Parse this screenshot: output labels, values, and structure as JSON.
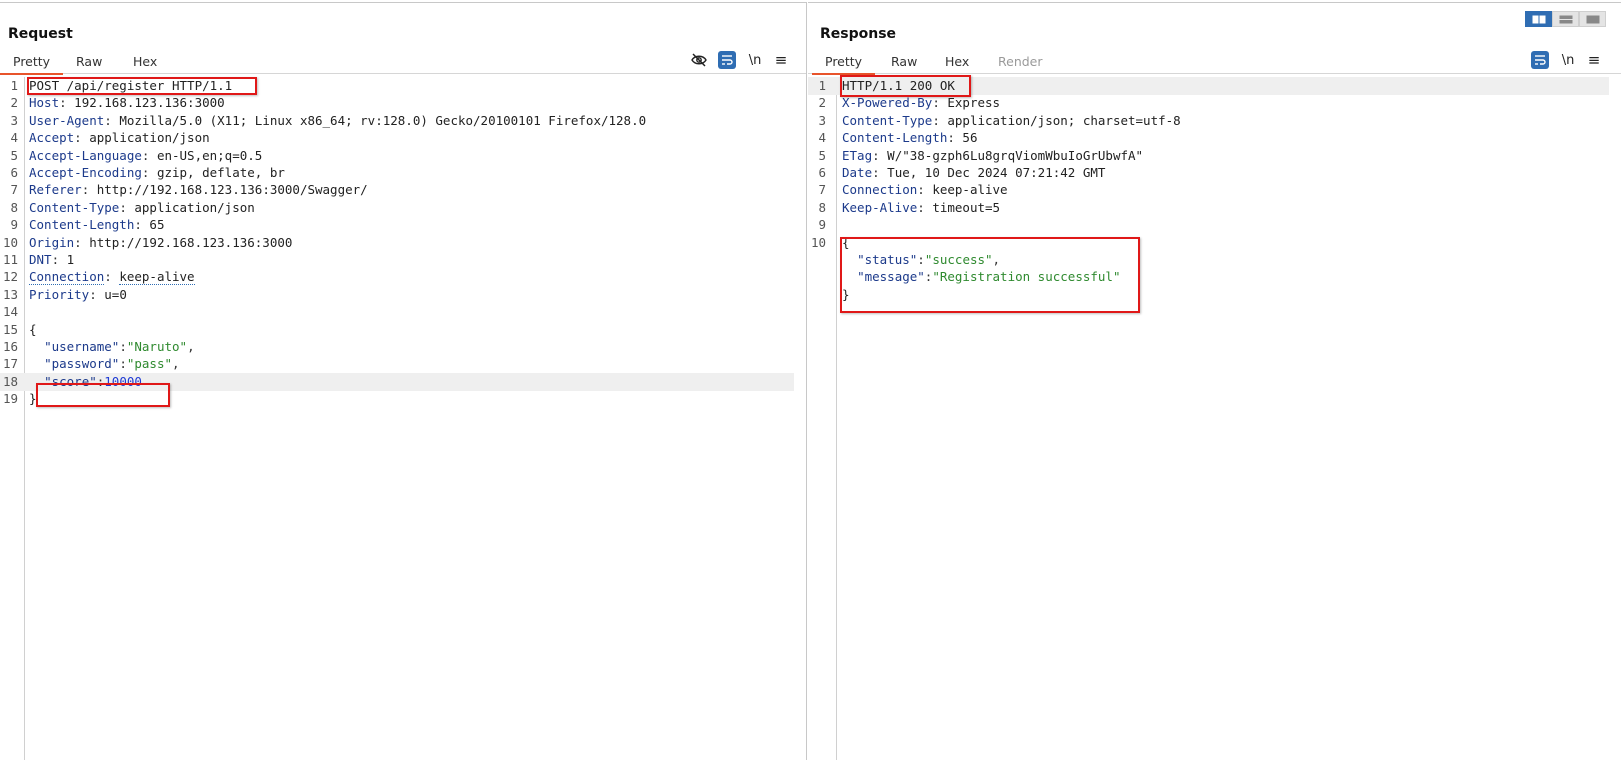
{
  "request": {
    "title": "Request",
    "tabs": [
      {
        "label": "Pretty",
        "active": true
      },
      {
        "label": "Raw",
        "active": false
      },
      {
        "label": "Hex",
        "active": false
      }
    ],
    "tools": {
      "newline_label": "\\n",
      "menu_label": "≡",
      "icons": [
        "eye-slash-icon",
        "wrap-icon",
        "newline-icon",
        "menu-icon"
      ]
    },
    "lines": [
      {
        "n": "1",
        "raw": "POST /api/register HTTP/1.1"
      },
      {
        "n": "2",
        "key": "Host",
        "sep": ": ",
        "val": "192.168.123.136:3000"
      },
      {
        "n": "3",
        "key": "User-Agent",
        "sep": ": ",
        "val": "Mozilla/5.0 (X11; Linux x86_64; rv:128.0) Gecko/20100101 Firefox/128.0"
      },
      {
        "n": "4",
        "key": "Accept",
        "sep": ": ",
        "val": "application/json"
      },
      {
        "n": "5",
        "key": "Accept-Language",
        "sep": ": ",
        "val": "en-US,en;q=0.5"
      },
      {
        "n": "6",
        "key": "Accept-Encoding",
        "sep": ": ",
        "val": "gzip, deflate, br"
      },
      {
        "n": "7",
        "key": "Referer",
        "sep": ": ",
        "val": "http://192.168.123.136:3000/Swagger/"
      },
      {
        "n": "8",
        "key": "Content-Type",
        "sep": ": ",
        "val": "application/json"
      },
      {
        "n": "9",
        "key": "Content-Length",
        "sep": ": ",
        "val": "65"
      },
      {
        "n": "10",
        "key": "Origin",
        "sep": ": ",
        "val": "http://192.168.123.136:3000"
      },
      {
        "n": "11",
        "key": "DNT",
        "sep": ": ",
        "val": "1"
      },
      {
        "n": "12",
        "key": "Connection",
        "sep": ": ",
        "val": "keep-alive"
      },
      {
        "n": "13",
        "key": "Priority",
        "sep": ": ",
        "val": "u=0"
      },
      {
        "n": "14",
        "raw": ""
      },
      {
        "n": "15",
        "raw": "{"
      },
      {
        "n": "16",
        "jkey": "\"username\"",
        "jsep": ":",
        "jstr": "\"Naruto\"",
        "tail": ","
      },
      {
        "n": "17",
        "jkey": "\"password\"",
        "jsep": ":",
        "jstr": "\"pass\"",
        "tail": ","
      },
      {
        "n": "18",
        "jkey": "\"score\"",
        "jsep": ":",
        "jnum": "10000",
        "tail": ""
      },
      {
        "n": "19",
        "raw": "}"
      }
    ]
  },
  "response": {
    "title": "Response",
    "tabs": [
      {
        "label": "Pretty",
        "active": true
      },
      {
        "label": "Raw",
        "active": false
      },
      {
        "label": "Hex",
        "active": false
      },
      {
        "label": "Render",
        "active": false,
        "disabled": true
      }
    ],
    "tools": {
      "newline_label": "\\n",
      "menu_label": "≡",
      "icons": [
        "wrap-icon",
        "newline-icon",
        "menu-icon"
      ]
    },
    "lines": [
      {
        "n": "1",
        "raw": "HTTP/1.1 200 OK"
      },
      {
        "n": "2",
        "key": "X-Powered-By",
        "sep": ": ",
        "val": "Express"
      },
      {
        "n": "3",
        "key": "Content-Type",
        "sep": ": ",
        "val": "application/json; charset=utf-8"
      },
      {
        "n": "4",
        "key": "Content-Length",
        "sep": ": ",
        "val": "56"
      },
      {
        "n": "5",
        "key": "ETag",
        "sep": ": ",
        "val": "W/\"38-gzph6Lu8grqViomWbuIoGrUbwfA\""
      },
      {
        "n": "6",
        "key": "Date",
        "sep": ": ",
        "val": "Tue, 10 Dec 2024 07:21:42 GMT"
      },
      {
        "n": "7",
        "key": "Connection",
        "sep": ": ",
        "val": "keep-alive"
      },
      {
        "n": "8",
        "key": "Keep-Alive",
        "sep": ": ",
        "val": "timeout=5"
      },
      {
        "n": "9",
        "raw": ""
      },
      {
        "n": "10",
        "raw": "{"
      },
      {
        "n": "",
        "jkey": "\"status\"",
        "jsep": ":",
        "jstr": "\"success\"",
        "tail": ","
      },
      {
        "n": "",
        "jkey": "\"message\"",
        "jsep": ":",
        "jstr": "\"Registration successful\"",
        "tail": ""
      },
      {
        "n": "",
        "raw": "}"
      }
    ]
  },
  "layout_toggle": {
    "selected": "side-by-side",
    "options": [
      "side-by-side",
      "top-bottom",
      "single"
    ]
  },
  "colors": {
    "accent_tab": "#e8542b",
    "tool_blue": "#2f6db3",
    "highlight_box": "#e01818",
    "header_key": "#1c3a8b",
    "json_string": "#2f8a2f",
    "json_number": "#1f3bd4"
  }
}
